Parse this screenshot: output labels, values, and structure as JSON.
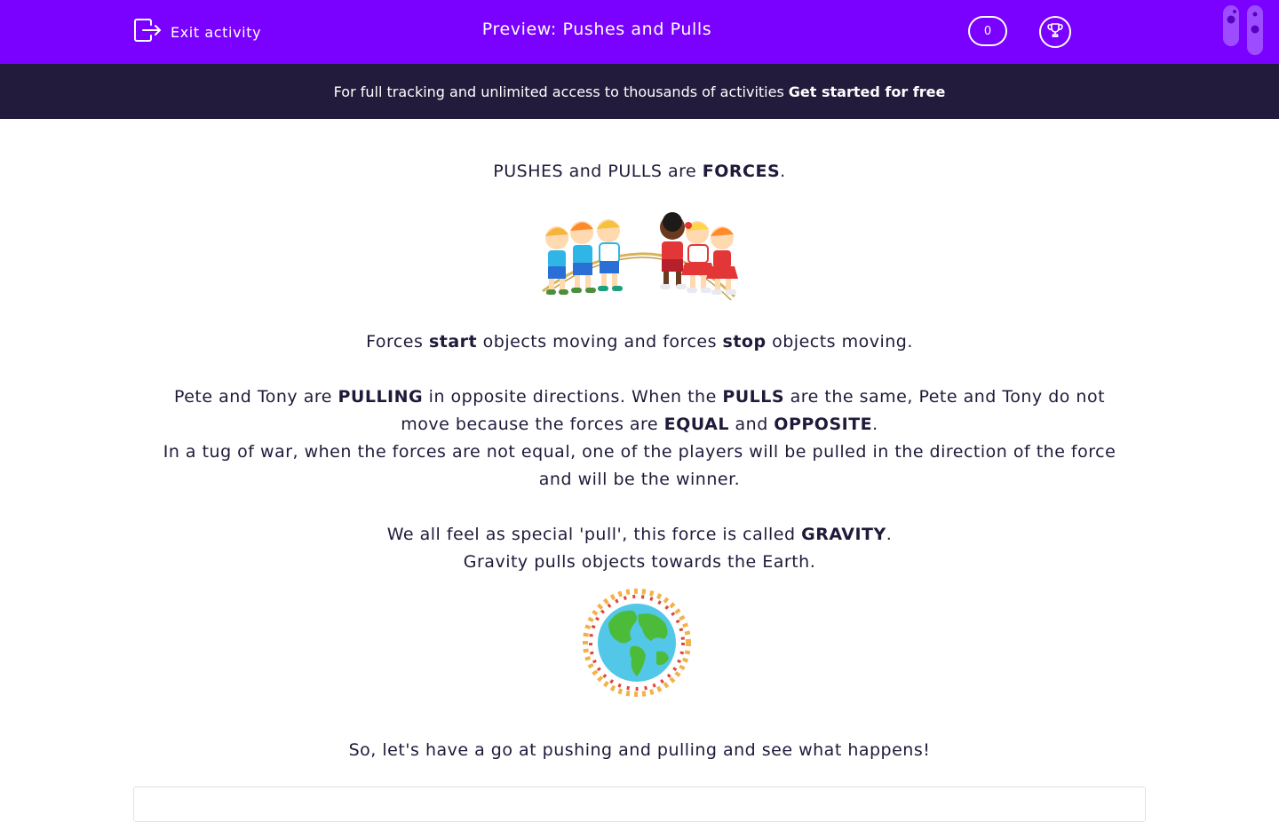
{
  "header": {
    "exit_label": "Exit activity",
    "title": "Preview: Pushes and Pulls",
    "score": "0"
  },
  "banner": {
    "text": "For full tracking and unlimited access to thousands of activities",
    "cta": "Get started for free"
  },
  "content": {
    "l1": {
      "a": "PUSHES and PULLS are ",
      "b": "FORCES",
      "c": "."
    },
    "l2": {
      "a": "Forces ",
      "b": "start",
      "c": " objects moving and forces ",
      "d": "stop",
      "e": " objects moving."
    },
    "l3": {
      "a": "Pete and Tony are ",
      "b": "PULLING",
      "c": " in opposite directions. When the ",
      "d": "PULLS",
      "e": " are the same, Pete and Tony do not"
    },
    "l4": {
      "a": "move because the forces are ",
      "b": "EQUAL",
      "c": " and ",
      "d": "OPPOSITE",
      "e": "."
    },
    "l5": "In a tug of war, when the forces are not equal, one of the players will be pulled in the direction of the force",
    "l6": "and will be the winner.",
    "l7": {
      "a": "We all feel as special 'pull', this force is called ",
      "b": "GRAVITY",
      "c": "."
    },
    "l8": "Gravity pulls objects towards the Earth.",
    "l9": "So, let's have a go at pushing and pulling and see what happens!"
  },
  "colors": {
    "header_bg": "#7a00ff",
    "banner_bg": "#231b3b",
    "text": "#1f1a3a"
  },
  "icons": {
    "exit": "exit-icon",
    "trophy": "trophy-icon",
    "brand": "brand-logo"
  }
}
